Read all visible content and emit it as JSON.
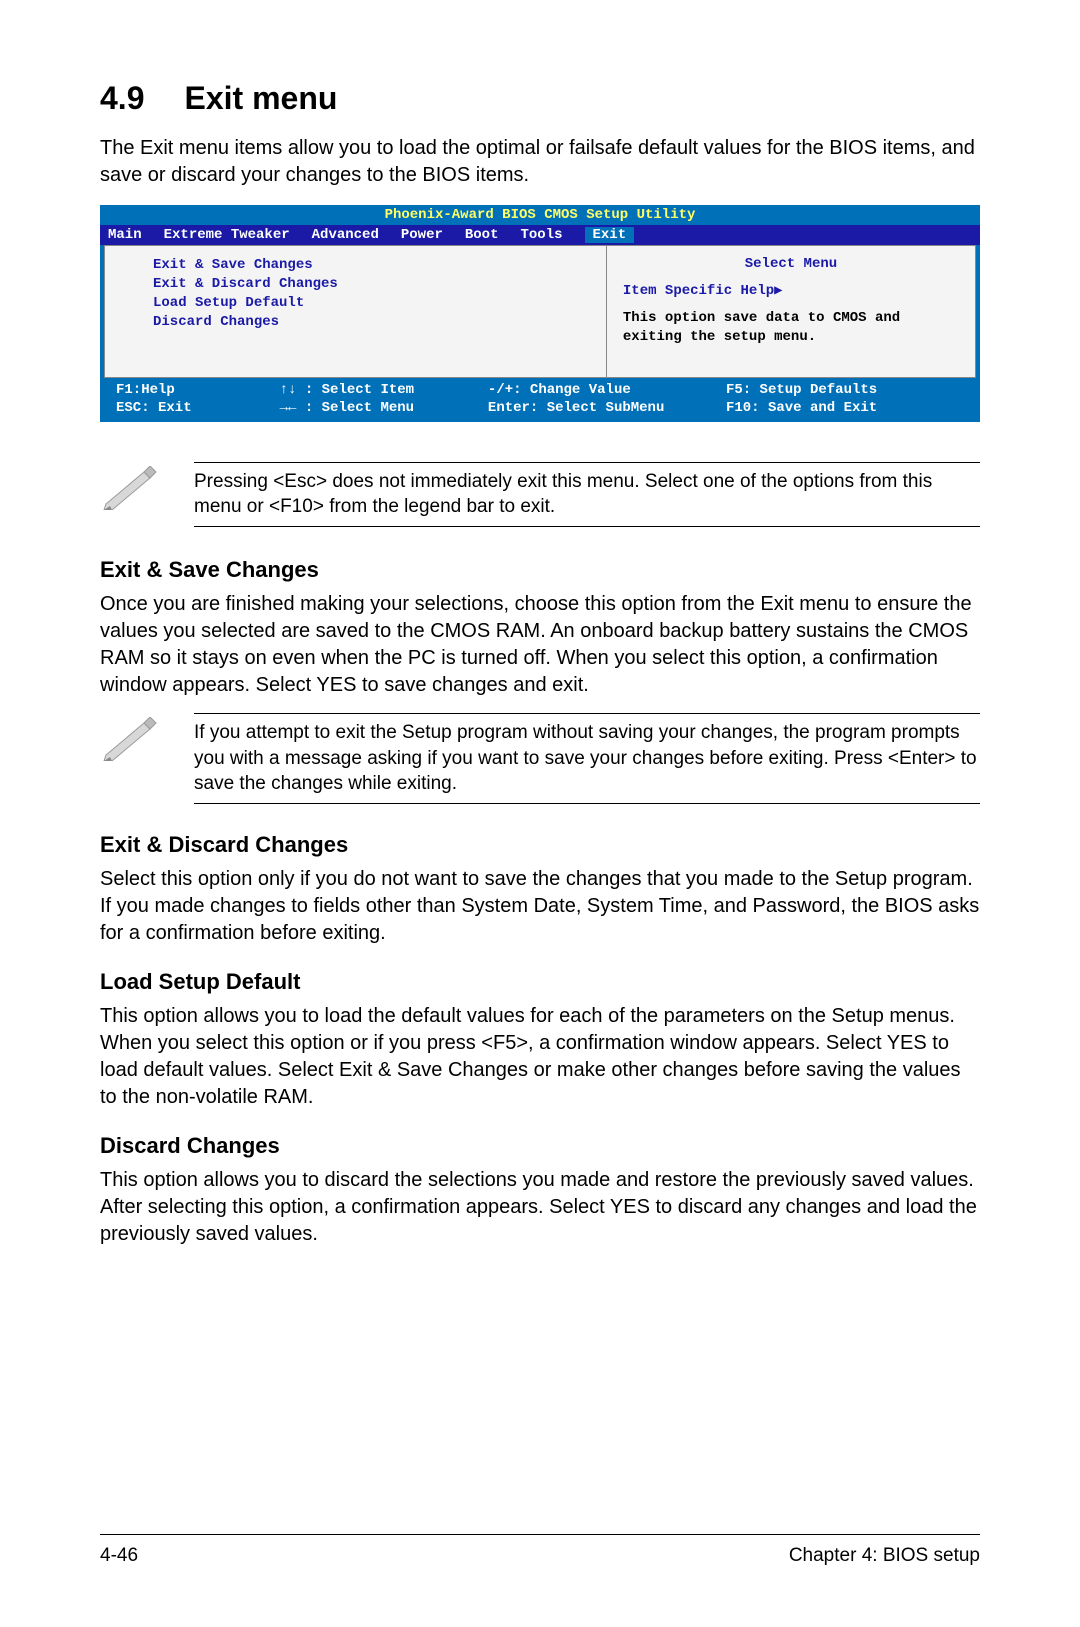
{
  "header": {
    "number": "4.9",
    "title": "Exit menu"
  },
  "intro": "The Exit menu items allow you to load the optimal or failsafe default values for the BIOS items, and save or discard your changes to the BIOS items.",
  "bios": {
    "title": "Phoenix-Award BIOS CMOS Setup Utility",
    "tabs": [
      "Main",
      "Extreme Tweaker",
      "Advanced",
      "Power",
      "Boot",
      "Tools",
      "Exit"
    ],
    "active_tab": "Exit",
    "left_items": [
      "Exit & Save Changes",
      "Exit & Discard Changes",
      "Load Setup Default",
      "Discard Changes"
    ],
    "right": {
      "select_menu": "Select Menu",
      "help_title": "Item Specific Help▶",
      "help_text": "This option save data to CMOS and exiting the setup menu."
    },
    "footer": {
      "c1a": "F1:Help",
      "c1b": "ESC: Exit",
      "c2a": "↑↓ : Select Item",
      "c2b": "→← : Select Menu",
      "c3a": "-/+: Change Value",
      "c3b": "Enter: Select SubMenu",
      "c4a": "F5: Setup Defaults",
      "c4b": "F10: Save and Exit"
    }
  },
  "note1": "Pressing <Esc> does not immediately exit this menu. Select one of the options from this menu or <F10> from the legend bar to exit.",
  "sections": {
    "s1_h": "Exit & Save Changes",
    "s1_p": "Once you are finished making your selections, choose this option from the Exit menu to ensure the values you selected are saved to the CMOS RAM. An onboard backup battery sustains the CMOS RAM so it stays on even when the PC is turned off. When you select this option, a confirmation window appears. Select YES to save changes and exit.",
    "note2": "If you attempt to exit the Setup program without saving your changes, the program prompts you with a message asking if you want to save your changes before exiting. Press <Enter> to save the changes while exiting.",
    "s2_h": "Exit & Discard Changes",
    "s2_p": "Select this option only if you do not want to save the changes that you made to the Setup program. If you made changes to fields other than System Date, System Time, and Password, the BIOS asks for a confirmation before exiting.",
    "s3_h": "Load Setup Default",
    "s3_p": "This option allows you to load the default values for each of the parameters on the Setup menus. When you select this option or if you press <F5>, a confirmation window appears. Select YES to load default values. Select Exit & Save Changes or make other changes before saving the values to the non-volatile RAM.",
    "s4_h": "Discard Changes",
    "s4_p": "This option allows you to discard the selections you made and restore the previously saved values. After selecting this option, a confirmation appears. Select YES to discard any changes and load the previously saved values."
  },
  "footer": {
    "page": "4-46",
    "chapter": "Chapter 4: BIOS setup"
  }
}
